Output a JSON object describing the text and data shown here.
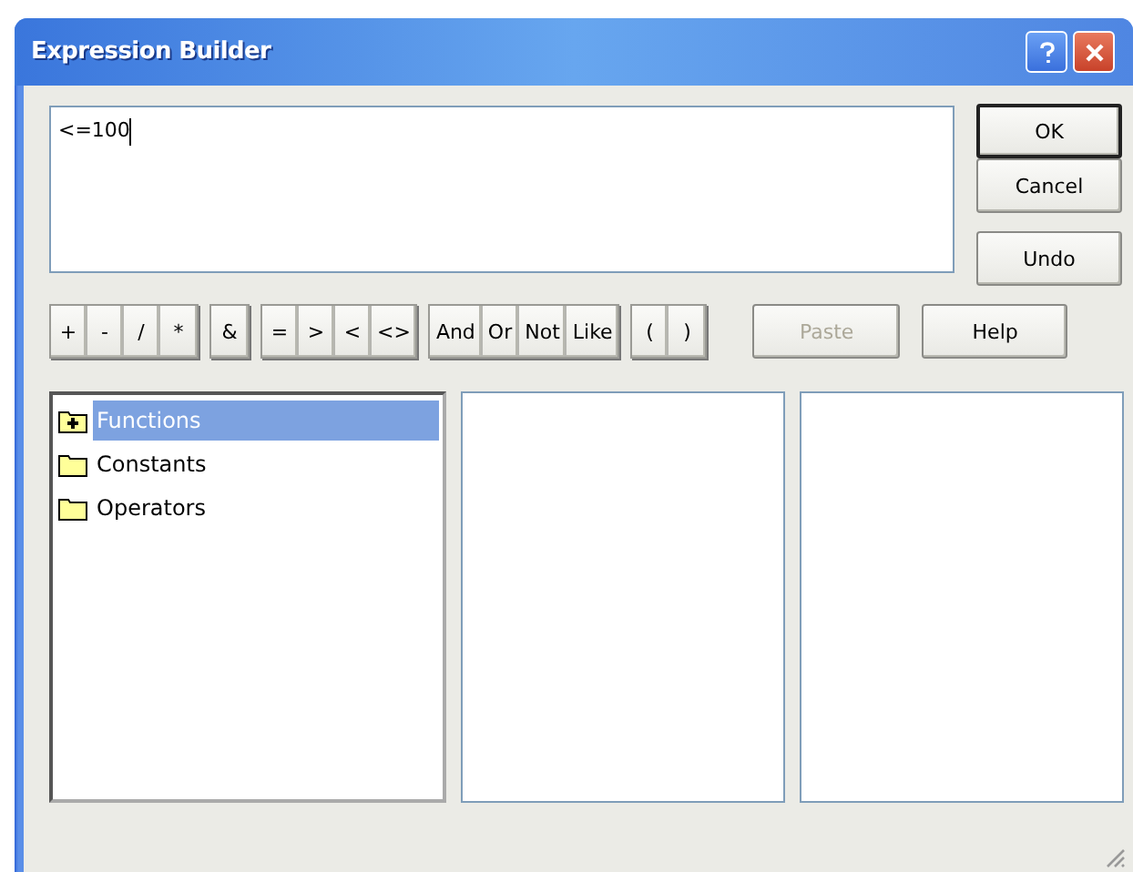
{
  "window": {
    "title": "Expression Builder"
  },
  "expression": {
    "value": "<=100"
  },
  "buttons": [
    {
      "label": "OK",
      "default": true
    },
    {
      "label": "Cancel",
      "default": false
    },
    {
      "label": "Undo",
      "default": false
    },
    {
      "label": "Help",
      "default": false
    }
  ],
  "operator_groups": [
    [
      "+",
      "-",
      "/",
      "*"
    ],
    [
      "&"
    ],
    [
      "=",
      ">",
      "<",
      "<>"
    ],
    [
      "And",
      "Or",
      "Not",
      "Like"
    ],
    [
      "(",
      ")"
    ]
  ],
  "paste": {
    "label": "Paste",
    "disabled": true
  },
  "tree": [
    {
      "label": "Functions",
      "selected": true,
      "expandable": true
    },
    {
      "label": "Constants",
      "selected": false,
      "expandable": false
    },
    {
      "label": "Operators",
      "selected": false,
      "expandable": false
    }
  ]
}
